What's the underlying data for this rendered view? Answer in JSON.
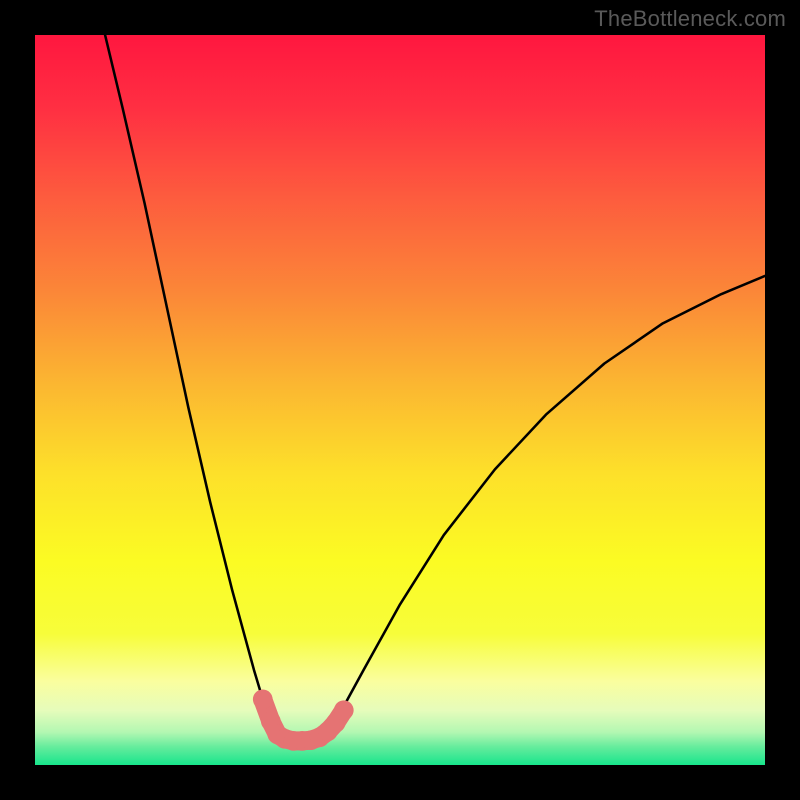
{
  "watermark": "TheBottleneck.com",
  "gradient": {
    "stops": [
      {
        "offset": 0.0,
        "color": "#ff173f"
      },
      {
        "offset": 0.1,
        "color": "#ff2f42"
      },
      {
        "offset": 0.22,
        "color": "#fd5b3e"
      },
      {
        "offset": 0.35,
        "color": "#fb8638"
      },
      {
        "offset": 0.48,
        "color": "#fbb731"
      },
      {
        "offset": 0.6,
        "color": "#fde02a"
      },
      {
        "offset": 0.72,
        "color": "#fbfb23"
      },
      {
        "offset": 0.82,
        "color": "#f7fd3a"
      },
      {
        "offset": 0.885,
        "color": "#fafe9e"
      },
      {
        "offset": 0.925,
        "color": "#e6fcbb"
      },
      {
        "offset": 0.955,
        "color": "#b3f7b2"
      },
      {
        "offset": 0.975,
        "color": "#66ec9d"
      },
      {
        "offset": 1.0,
        "color": "#18e58c"
      }
    ]
  },
  "chart_data": {
    "type": "line",
    "title": "",
    "xlabel": "",
    "ylabel": "",
    "xlim": [
      0,
      100
    ],
    "ylim": [
      0,
      100
    ],
    "curve": {
      "comment": "V-shaped bottleneck curve; flat trough between x≈33 and x≈40 at y≈3.5; left arm rises to y=100 at x≈9.6; right arm rises to y≈67 at x=100",
      "points": [
        {
          "x": 9.6,
          "y": 100.0
        },
        {
          "x": 12.0,
          "y": 90.0
        },
        {
          "x": 15.0,
          "y": 77.0
        },
        {
          "x": 18.0,
          "y": 63.0
        },
        {
          "x": 21.0,
          "y": 49.0
        },
        {
          "x": 24.0,
          "y": 36.0
        },
        {
          "x": 27.0,
          "y": 24.0
        },
        {
          "x": 30.0,
          "y": 13.0
        },
        {
          "x": 31.5,
          "y": 8.0
        },
        {
          "x": 33.0,
          "y": 4.5
        },
        {
          "x": 34.5,
          "y": 3.5
        },
        {
          "x": 36.5,
          "y": 3.3
        },
        {
          "x": 38.5,
          "y": 3.5
        },
        {
          "x": 40.0,
          "y": 4.5
        },
        {
          "x": 42.0,
          "y": 7.5
        },
        {
          "x": 45.0,
          "y": 13.0
        },
        {
          "x": 50.0,
          "y": 22.0
        },
        {
          "x": 56.0,
          "y": 31.5
        },
        {
          "x": 63.0,
          "y": 40.5
        },
        {
          "x": 70.0,
          "y": 48.0
        },
        {
          "x": 78.0,
          "y": 55.0
        },
        {
          "x": 86.0,
          "y": 60.5
        },
        {
          "x": 94.0,
          "y": 64.5
        },
        {
          "x": 100.0,
          "y": 67.0
        }
      ]
    },
    "markers": {
      "comment": "salmon circles along the trough",
      "color": "#e57373",
      "radius": 1.35,
      "points": [
        {
          "x": 31.2,
          "y": 9.0
        },
        {
          "x": 32.3,
          "y": 6.0
        },
        {
          "x": 33.2,
          "y": 4.2
        },
        {
          "x": 34.2,
          "y": 3.6
        },
        {
          "x": 35.4,
          "y": 3.3
        },
        {
          "x": 36.6,
          "y": 3.3
        },
        {
          "x": 37.8,
          "y": 3.4
        },
        {
          "x": 39.0,
          "y": 3.8
        },
        {
          "x": 40.1,
          "y": 4.6
        },
        {
          "x": 41.2,
          "y": 5.8
        },
        {
          "x": 42.3,
          "y": 7.5
        }
      ]
    }
  }
}
